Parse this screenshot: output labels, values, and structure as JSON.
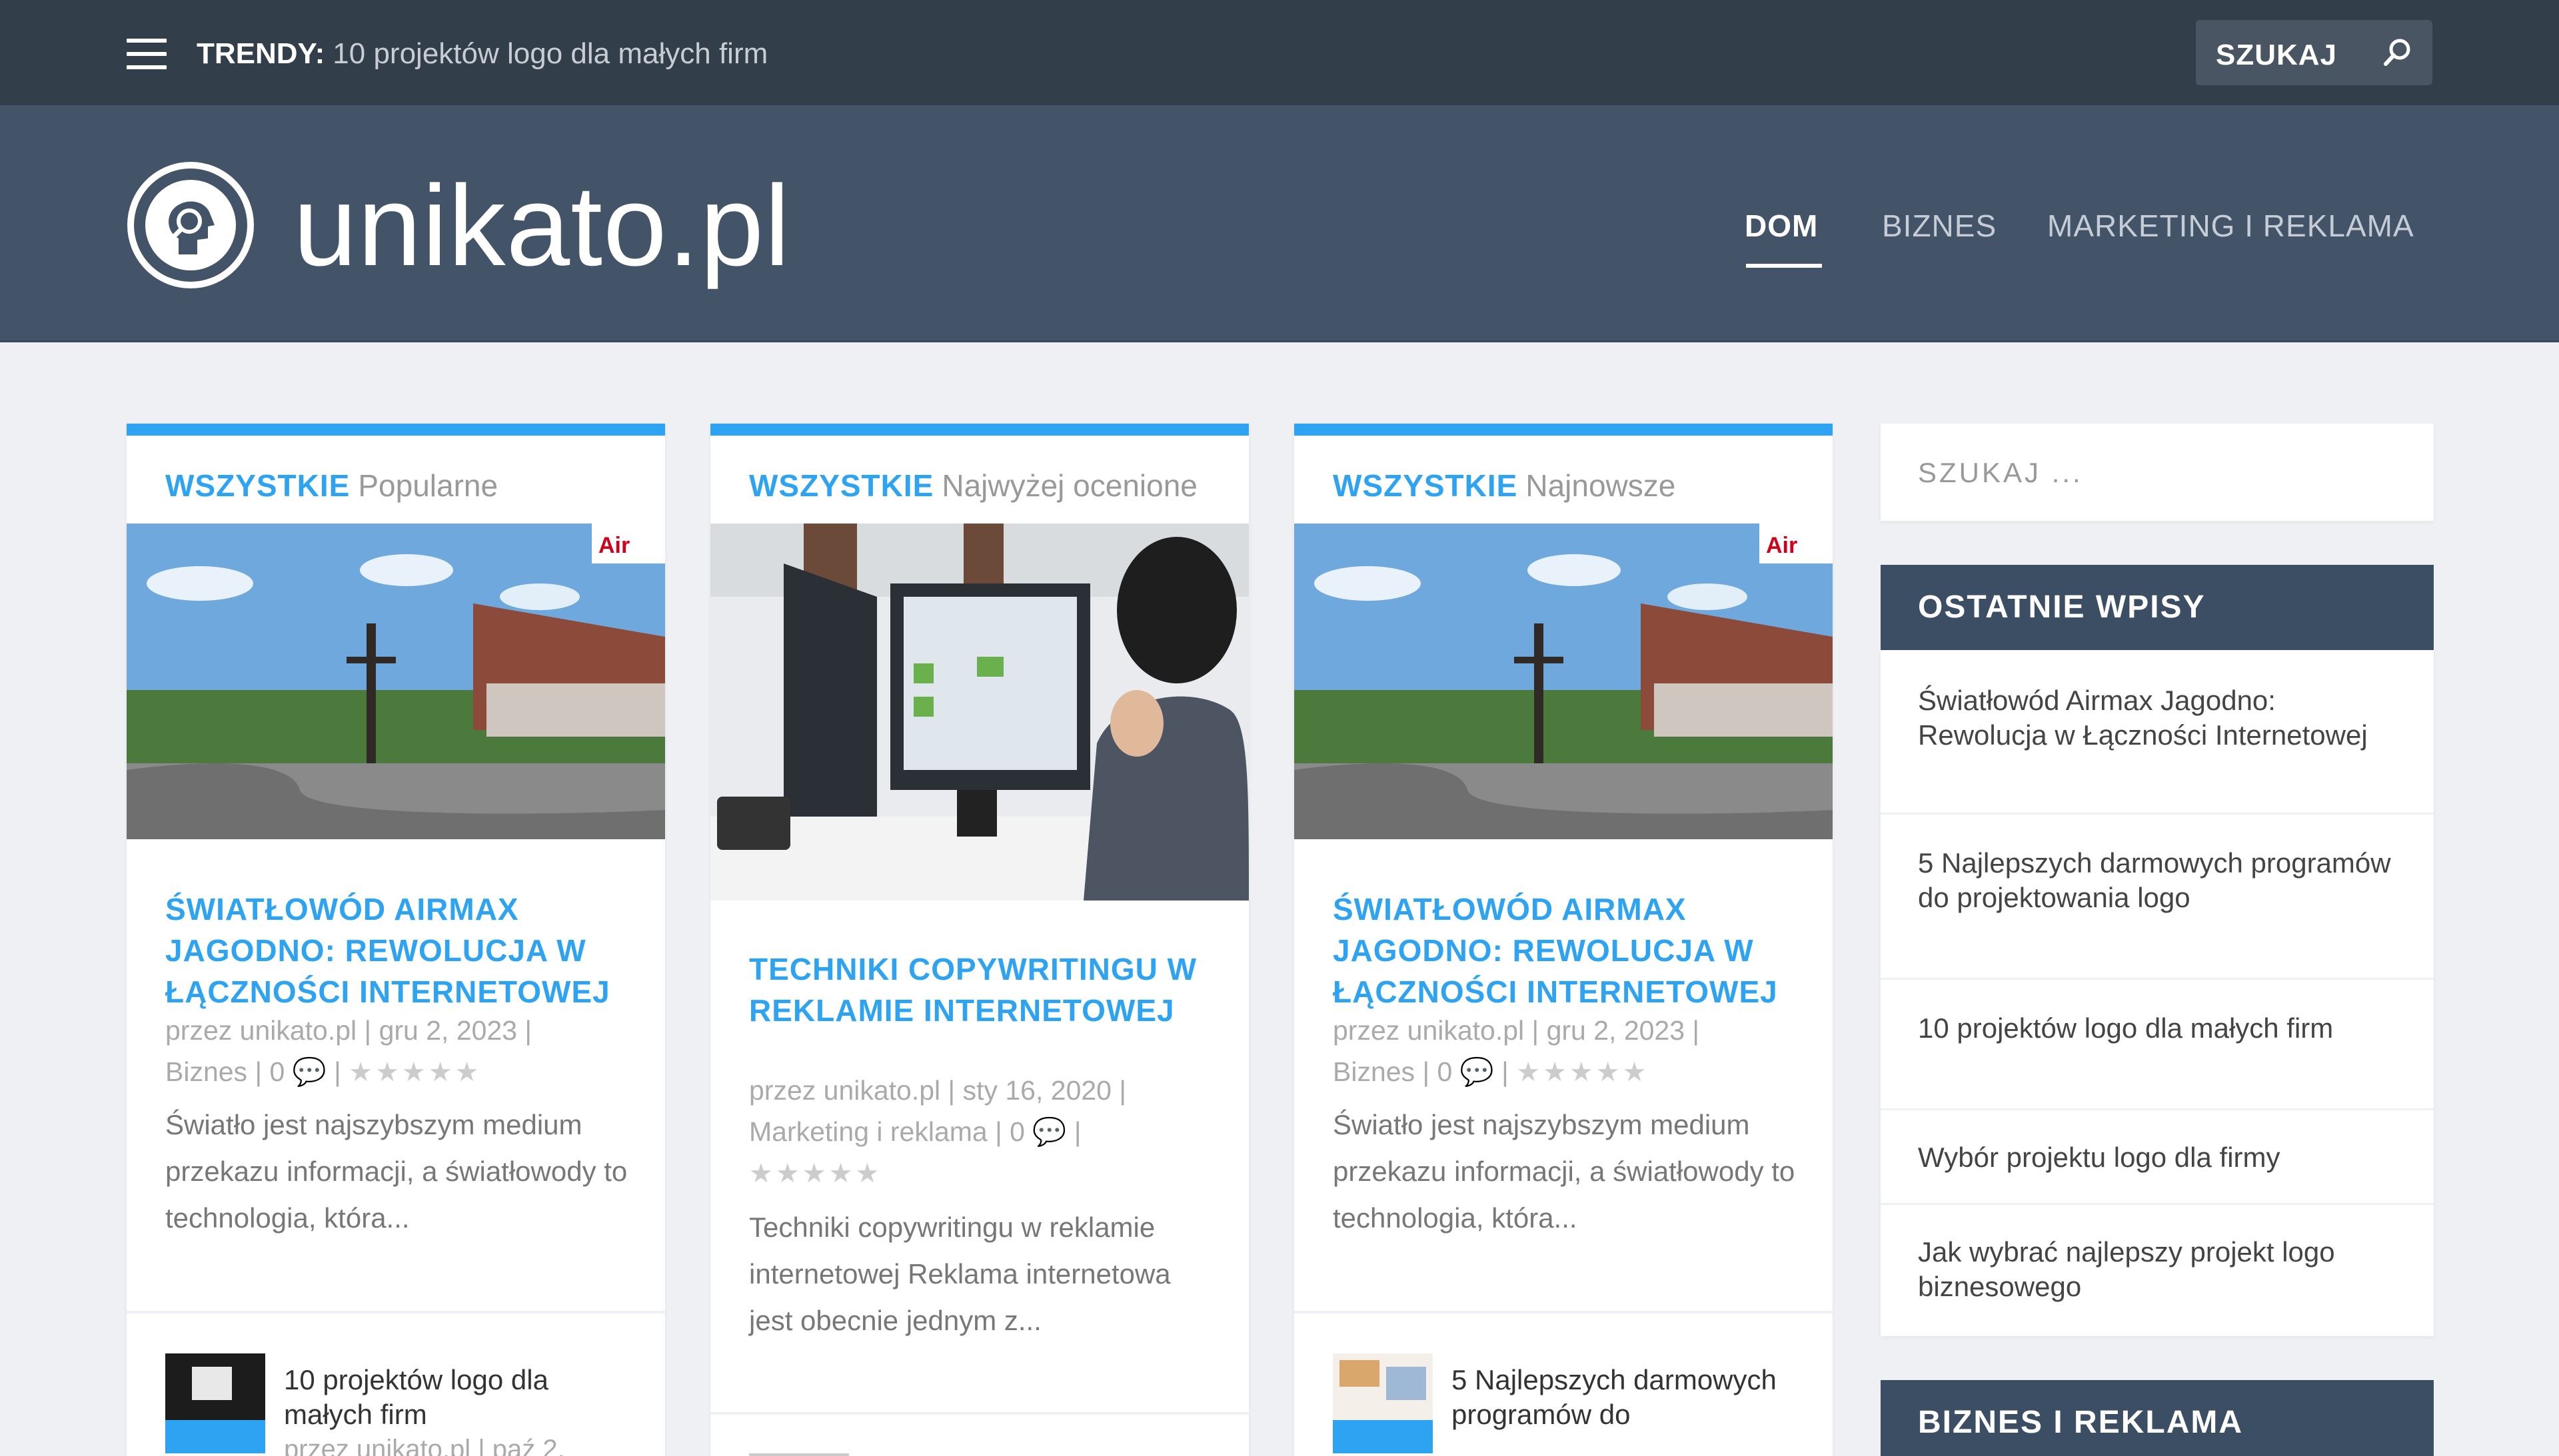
{
  "topbar": {
    "trending_label": "TRENDY:",
    "trending_text": "10 projektów logo dla małych firm",
    "search_label": "SZUKAJ"
  },
  "header": {
    "site_title": "unikato.pl",
    "nav": [
      {
        "label": "DOM",
        "active": true
      },
      {
        "label": "BIZNES",
        "active": false
      },
      {
        "label": "MARKETING I REKLAMA",
        "active": false
      }
    ]
  },
  "cards": [
    {
      "tab_all": "WSZYSTKIE",
      "tab_sub": "Popularne",
      "title": "Światłowód Airmax Jagodno: Rewolucja w Łączności Internetowej",
      "meta_line1": "przez unikato.pl | gru 2, 2023 |",
      "meta_line2": "Biznes | 0",
      "excerpt": "Światło jest najszybszym medium przekazu informacji, a światłowody to technologia, która...",
      "mini_title": "10 projektów logo dla małych firm",
      "mini_meta": "przez unikato.pl | paź 2,"
    },
    {
      "tab_all": "WSZYSTKIE",
      "tab_sub": "Najwyżej ocenione",
      "title": "Techniki copywritingu w reklamie internetowej",
      "meta_line1": "przez unikato.pl | sty 16, 2020 |",
      "meta_line2": "Marketing i reklama | 0",
      "excerpt": "Techniki copywritingu w reklamie internetowej Reklama internetowa jest obecnie jednym z...",
      "mini_title": "",
      "mini_meta": ""
    },
    {
      "tab_all": "WSZYSTKIE",
      "tab_sub": "Najnowsze",
      "title": "Światłowód Airmax Jagodno: Rewolucja w Łączności Internetowej",
      "meta_line1": "przez unikato.pl | gru 2, 2023 |",
      "meta_line2": "Biznes | 0",
      "excerpt": "Światło jest najszybszym medium przekazu informacji, a światłowody to technologia, która...",
      "mini_title": "5 Najlepszych darmowych programów do",
      "mini_meta": ""
    }
  ],
  "sidebar": {
    "search_placeholder": "SZUKAJ ...",
    "recent_heading": "OSTATNIE WPISY",
    "recent_posts": [
      "Światłowód Airmax Jagodno: Rewolucja w Łączności Internetowej",
      "5 Najlepszych darmowych programów do projektowania logo",
      "10 projektów logo dla małych firm",
      "Wybór projektu logo dla firmy",
      "Jak wybrać najlepszy projekt logo biznesowego"
    ],
    "category_heading": "BIZNES I REKLAMA"
  },
  "colors": {
    "accent": "#2ea3f2",
    "topbar": "#333e4b",
    "header": "#435469",
    "widget_head": "#3c4e64"
  }
}
